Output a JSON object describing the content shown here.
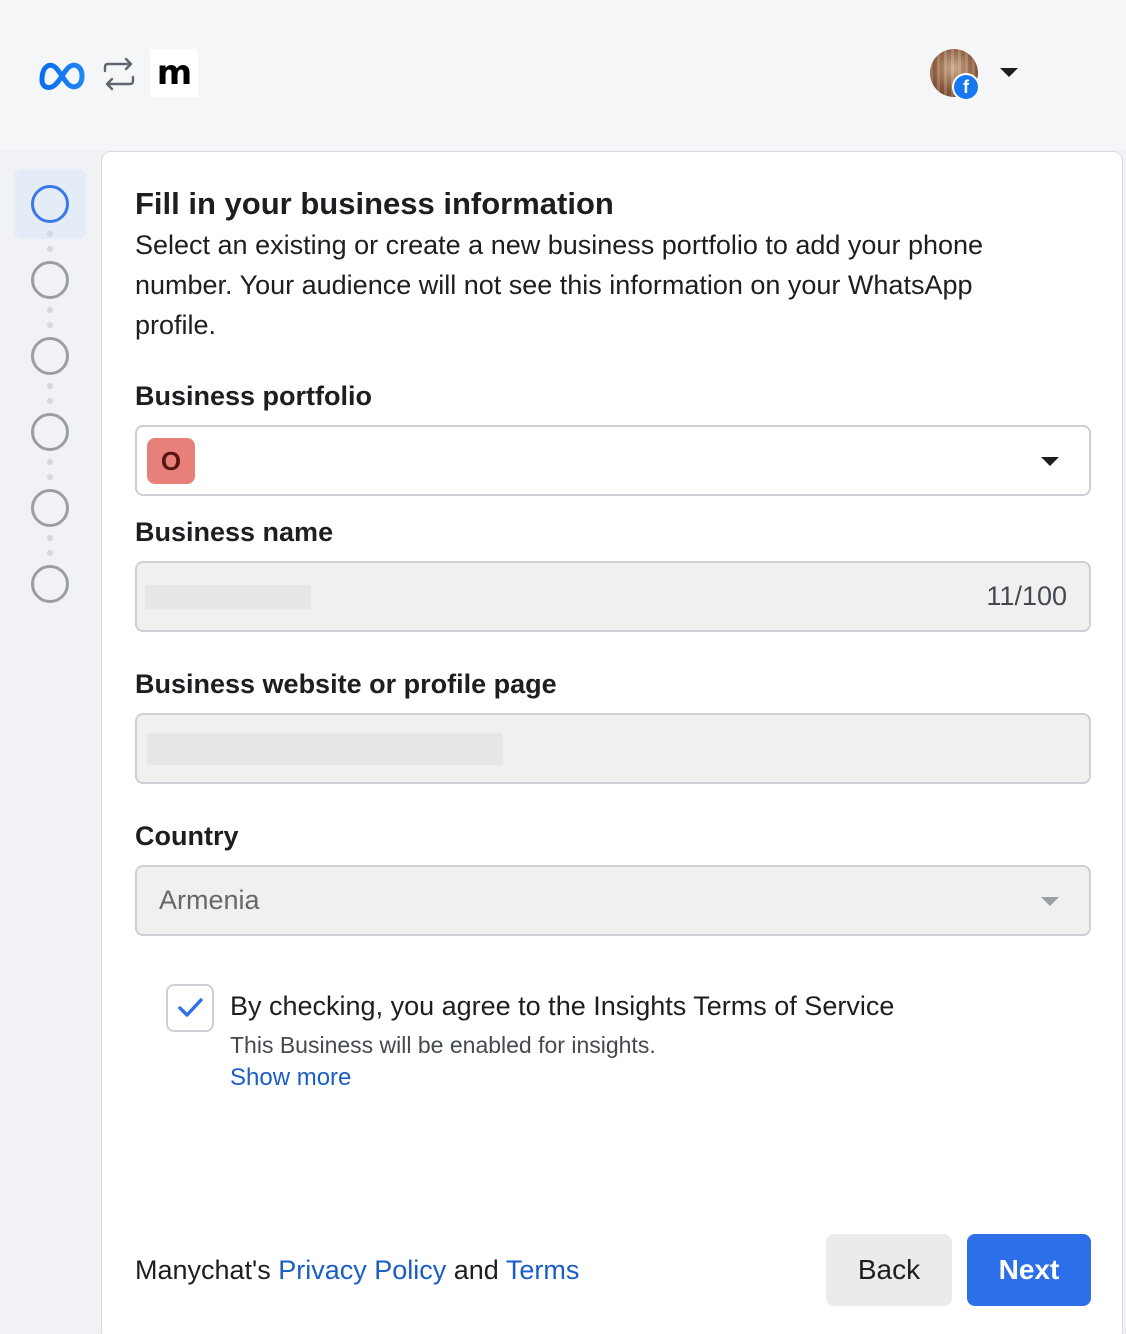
{
  "header": {
    "left_icons": [
      "meta-logo-icon",
      "swap-arrows-icon",
      "manychat-logo-icon"
    ],
    "manychat_logo_text": "m",
    "account": {
      "badge_letter": "f",
      "icon": "facebook-icon"
    }
  },
  "stepper": {
    "total_steps": 6,
    "active_step": 1
  },
  "form": {
    "title": "Fill in your business information",
    "subtitle": "Select an existing or create a new business portfolio to add your phone number. Your audience will not see this information on your WhatsApp profile.",
    "business_portfolio": {
      "label": "Business portfolio",
      "badge": "O"
    },
    "business_name": {
      "label": "Business name",
      "counter": "11/100"
    },
    "business_website": {
      "label": "Business website or profile page"
    },
    "country": {
      "label": "Country",
      "value": "Armenia"
    },
    "agreement": {
      "checked": true,
      "text": "By checking, you agree to the Insights Terms of Service",
      "subtext": "This Business will be enabled for insights.",
      "show_more": "Show more"
    }
  },
  "footer": {
    "prefix": "Manychat's ",
    "privacy_link": "Privacy Policy",
    "and": " and ",
    "terms_link": "Terms",
    "back_label": "Back",
    "next_label": "Next"
  },
  "colors": {
    "accent": "#2d6fe8",
    "link": "#1a5dc7",
    "portfolio_badge": "#e8807a",
    "step_active": "#3a78e8"
  }
}
